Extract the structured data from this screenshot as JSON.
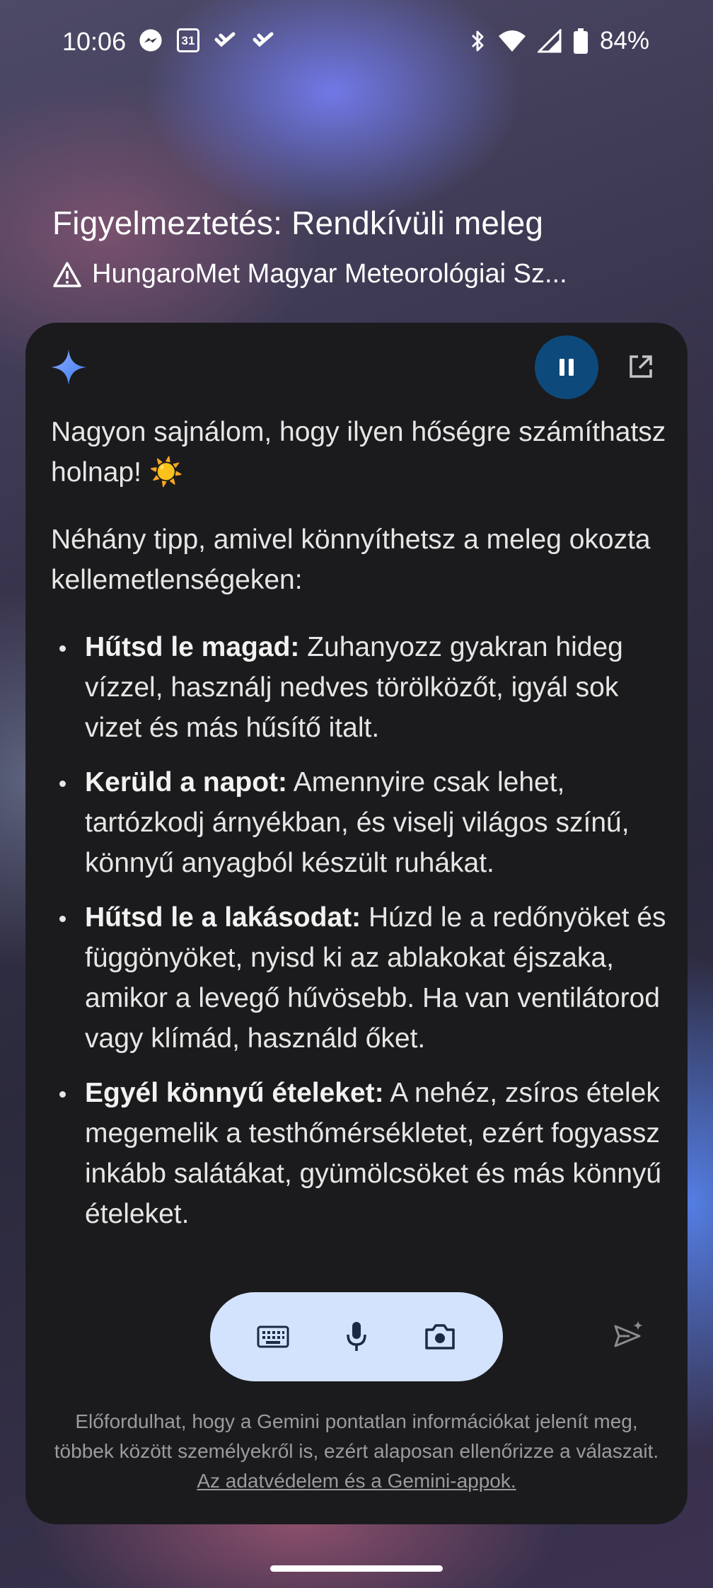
{
  "status_bar": {
    "time": "10:06",
    "left_icons": [
      "messenger-icon",
      "calendar-icon",
      "app-notification-icon",
      "app-notification-icon"
    ],
    "calendar_day": "31",
    "right_icons": [
      "bluetooth-icon",
      "wifi-icon",
      "signal-icon",
      "battery-icon"
    ],
    "battery_percent": "84%"
  },
  "alert": {
    "title": "Figyelmeztetés: Rendkívüli meleg",
    "source": "HungaroMet Magyar Meteorológiai Sz..."
  },
  "gemini": {
    "intro": "Nagyon sajnálom, hogy ilyen hőségre számíthatsz holnap! ☀️",
    "lead": "Néhány tipp, amivel könnyíthetsz a meleg okozta kellemetlenségeken:",
    "tips": [
      {
        "title": "Hűtsd le magad:",
        "text": " Zuhanyozz gyakran hideg vízzel, használj nedves törölközőt, igyál sok vizet és más hűsítő italt."
      },
      {
        "title": "Kerüld a napot:",
        "text": " Amennyire csak lehet, tartózkodj árnyékban, és viselj világos színű, könnyű anyagból készült ruhákat."
      },
      {
        "title": "Hűtsd le a lakásodat:",
        "text": " Húzd le a redőnyöket és függönyöket, nyisd ki az ablakokat éjszaka, amikor a levegő hűvösebb. Ha van ventilátorod vagy klímád, használd őket."
      },
      {
        "title": "Egyél könnyű ételeket:",
        "text": " A nehéz, zsíros ételek megemelik a testhőmérsékletet, ezért fogyassz inkább salátákat, gyümölcsöket és más könnyű ételeket."
      }
    ],
    "disclaimer": "Előfordulhat, hogy a Gemini pontatlan információkat jelenít meg, többek között személyekről is, ezért alaposan ellenőrizze a válaszait. ",
    "privacy_link": "Az adatvédelem és a Gemini-appok.",
    "controls": {
      "pause_icon": "pause-icon",
      "open_icon": "open-external-icon",
      "keyboard_icon": "keyboard-icon",
      "mic_icon": "microphone-icon",
      "camera_icon": "camera-icon",
      "send_icon": "send-sparkle-icon"
    }
  },
  "colors": {
    "card_bg": "#1b1b1d",
    "pill_bg": "#d3e3fd",
    "pause_bg": "#0d4a7b",
    "sparkle_blue": "#4a8cf7"
  }
}
